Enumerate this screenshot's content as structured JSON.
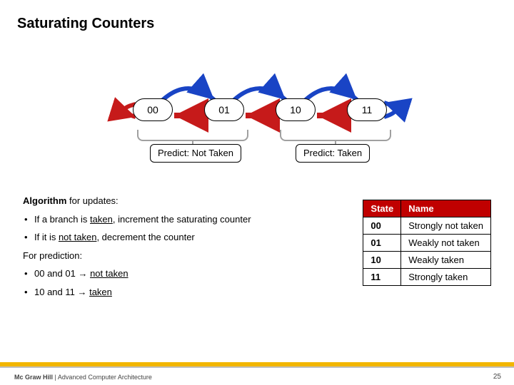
{
  "title": "Saturating Counters",
  "states": {
    "s00": "00",
    "s01": "01",
    "s10": "10",
    "s11": "11"
  },
  "predict": {
    "left": "Predict: Not Taken",
    "right": "Predict: Taken"
  },
  "algo": {
    "updates_hdr_prefix": "Algorithm",
    "updates_hdr_rest": " for updates:",
    "bullet1_a": "If a branch is ",
    "bullet1_u": "taken",
    "bullet1_b": ", increment the saturating counter",
    "bullet2_a": "If it is ",
    "bullet2_u": "not taken",
    "bullet2_b": ", decrement the counter",
    "pred_hdr": "For prediction:",
    "bullet3_a": "00 and 01 → ",
    "bullet3_u": "not taken",
    "bullet4_a": "10 and 11 → ",
    "bullet4_u": "taken"
  },
  "table": {
    "head_state": "State",
    "head_name": "Name",
    "rows": [
      {
        "state": "00",
        "name": "Strongly not taken"
      },
      {
        "state": "01",
        "name": "Weakly not taken"
      },
      {
        "state": "10",
        "name": "Weakly taken"
      },
      {
        "state": "11",
        "name": "Strongly taken"
      }
    ]
  },
  "footer": {
    "publisher": "Mc Graw Hill",
    "sep": " | ",
    "book": "Advanced Computer Architecture",
    "page": "25"
  },
  "colors": {
    "accent": "#c00000",
    "bar": "#f2b600"
  }
}
